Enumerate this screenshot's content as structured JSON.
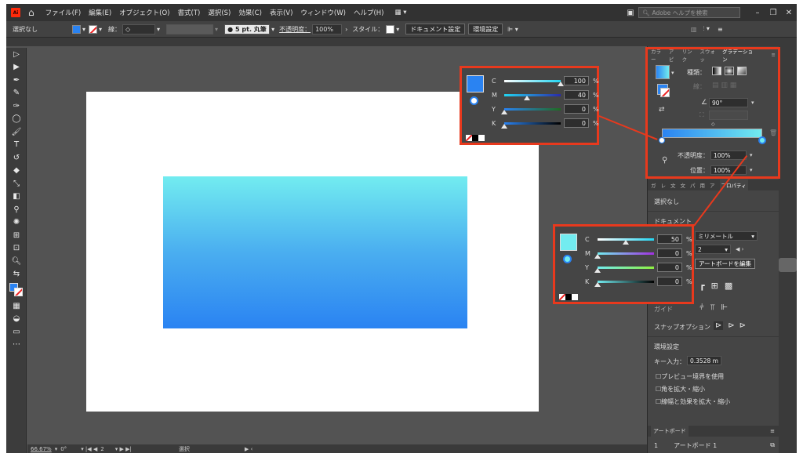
{
  "menubar": {
    "logo": "Ai",
    "items": [
      "ファイル(F)",
      "編集(E)",
      "オブジェクト(O)",
      "書式(T)",
      "選択(S)",
      "効果(C)",
      "表示(V)",
      "ウィンドウ(W)",
      "ヘルプ(H)"
    ],
    "search_placeholder": "Adobe ヘルプを検索"
  },
  "control_bar": {
    "selection": "選択なし",
    "stroke_label": "線：",
    "brush": "5 pt. 丸筆",
    "opacity_label": "不透明度：",
    "opacity_value": "100%",
    "style_label": "スタイル：",
    "doc_setup": "ドキュメント設定",
    "prefs": "環境設定"
  },
  "gradient_panel": {
    "tabs": [
      "カラー",
      "アピ",
      "リンク",
      "スウォッ",
      "グラデーション"
    ],
    "type_label": "種類：",
    "stroke_label": "線：",
    "angle_value": "90°",
    "opacity_label": "不透明度：",
    "opacity_value": "100%",
    "position_label": "位置：",
    "position_value": "100%",
    "colors": {
      "start": "#2a83f2",
      "end": "#72ecf0"
    }
  },
  "properties_panel": {
    "tabs": [
      "ガ",
      "レ",
      "文",
      "文",
      "パ",
      "用",
      "ア",
      "プロパティ"
    ],
    "no_selection": "選択なし",
    "document_label": "ドキュメント",
    "units": "ミリメートル",
    "artboard_num": "2",
    "edit_artboard": "アートボードを編集",
    "snap_options": "スナップオプション",
    "prefs_label": "環境設定",
    "key_input_label": "キー入力：",
    "key_input_value": "0.3528 m",
    "check_preview": "プレビュー境界を使用",
    "check_corners": "角を拡大・縮小",
    "check_strokes": "線幅と効果を拡大・縮小",
    "artboards_tab": "アートボード",
    "artboard_row_num": "1",
    "artboard_row_name": "アートボード 1"
  },
  "callout_top": {
    "swatch": "#2a83f2",
    "rows": [
      {
        "label": "C",
        "value": "100",
        "unit": "%"
      },
      {
        "label": "M",
        "value": "40",
        "unit": "%"
      },
      {
        "label": "Y",
        "value": "0",
        "unit": "%"
      },
      {
        "label": "K",
        "value": "0",
        "unit": "%"
      }
    ]
  },
  "callout_bottom": {
    "swatch": "#72ecf0",
    "rows": [
      {
        "label": "C",
        "value": "50",
        "unit": "%"
      },
      {
        "label": "M",
        "value": "0",
        "unit": "%"
      },
      {
        "label": "Y",
        "value": "0",
        "unit": "%"
      },
      {
        "label": "K",
        "value": "0",
        "unit": "%"
      }
    ]
  },
  "status_bar": {
    "zoom": "66.67%",
    "rotation": "0°",
    "artboard": "2",
    "mode": "選択"
  }
}
